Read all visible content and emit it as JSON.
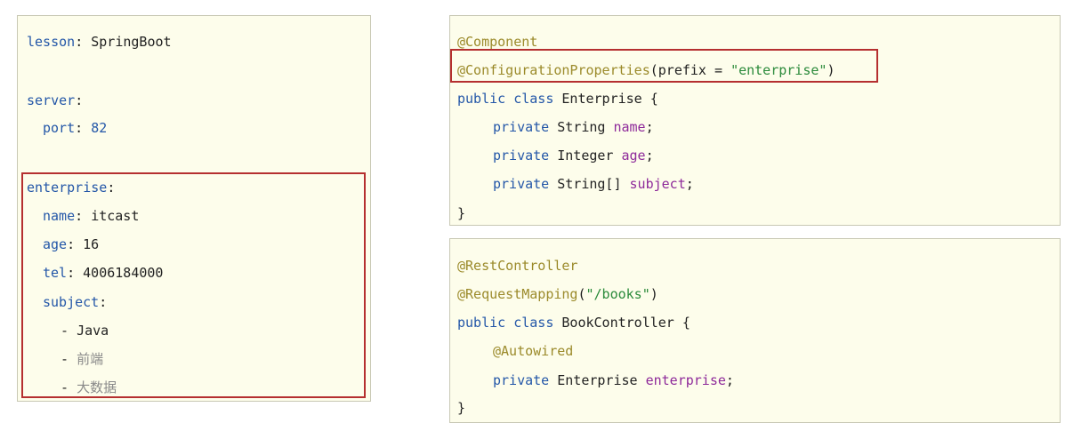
{
  "yaml": {
    "lesson_key": "lesson",
    "lesson_value": "SpringBoot",
    "server_key": "server",
    "port_key": "port",
    "port_value": "82",
    "enterprise_key": "enterprise",
    "name_key": "name",
    "name_value": "itcast",
    "age_key": "age",
    "age_value": "16",
    "tel_key": "tel",
    "tel_value": "4006184000",
    "subject_key": "subject",
    "subjects": [
      "Java",
      "前端",
      "大数据"
    ]
  },
  "enterprise_class": {
    "ann1": "@Component",
    "ann2": "@ConfigurationProperties",
    "ann2_param": "(prefix = ",
    "ann2_string": "\"enterprise\"",
    "ann2_close": ")",
    "kw_public_class": "public class",
    "class_name": "Enterprise {",
    "fields": [
      {
        "mod": "private",
        "type": "String",
        "name": "name"
      },
      {
        "mod": "private",
        "type": "Integer",
        "name": "age"
      },
      {
        "mod": "private",
        "type": "String[]",
        "name": "subject"
      }
    ],
    "semicolon": ";",
    "close": "}"
  },
  "controller_class": {
    "ann1": "@RestController",
    "ann2": "@RequestMapping",
    "ann2_open": "(",
    "ann2_string": "\"/books\"",
    "ann2_close": ")",
    "kw_public_class": "public class",
    "class_name": "BookController {",
    "ann3": "@Autowired",
    "field_mod": "private",
    "field_type": "Enterprise",
    "field_name": "enterprise",
    "semicolon": ";",
    "close": "}"
  },
  "colors": {
    "panel_bg": "#fdfdeb",
    "highlight_border": "#b52f2f",
    "key_blue": "#2457a8",
    "annotation": "#9b8a2a",
    "field_purple": "#8e2a9a",
    "string_green": "#2a8a3a"
  }
}
